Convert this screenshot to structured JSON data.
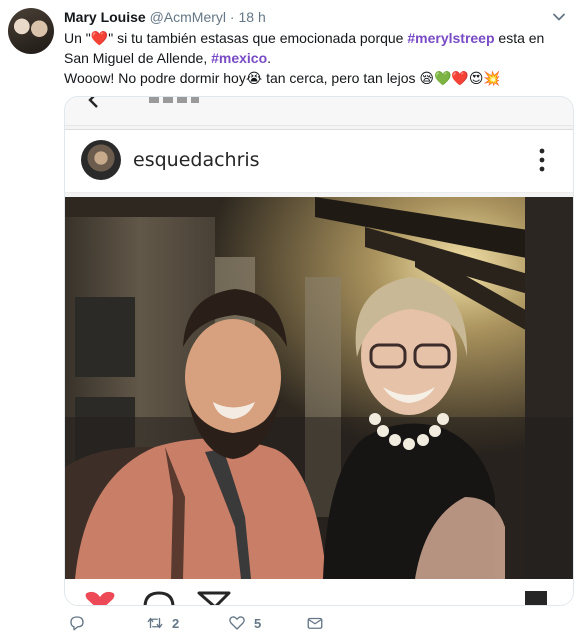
{
  "tweet": {
    "author_name": "Mary Louise",
    "author_handle": "@AcmMeryl",
    "separator": "·",
    "time": "18 h",
    "line1_prefix": "Un \"",
    "line1_heart": "❤️",
    "line1_mid": "\" si tu también estasas que emocionada porque ",
    "line1_hashtag": "#merylstreep",
    "line1_suffix": " esta en",
    "line2_prefix": "San Miguel de Allende, ",
    "line2_hashtag": "#mexico",
    "line2_suffix": ".",
    "line3": "Wooow! No podre dormir hoy😭 tan cerca, pero tan lejos 😪💚❤️😍💥"
  },
  "embedded_post": {
    "username": "esquedachris"
  },
  "actions": {
    "reply_count": "",
    "retweet_count": "2",
    "like_count": "5"
  },
  "colors": {
    "hashtag": "#794bc4",
    "heart": "#e0245e",
    "secondary_text": "#657786"
  }
}
